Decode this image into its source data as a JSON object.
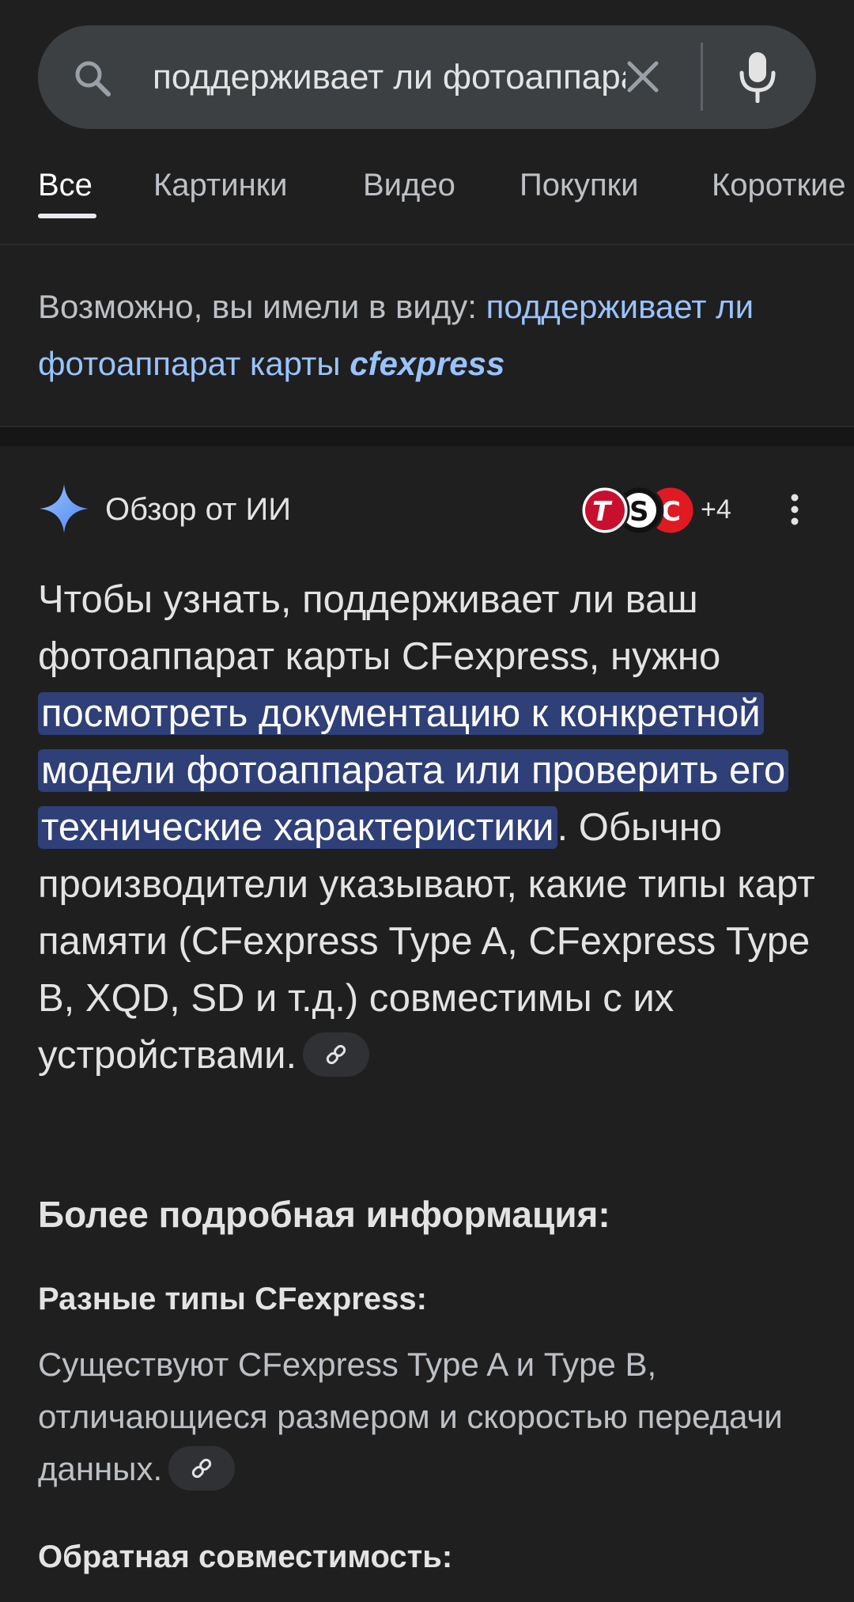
{
  "search": {
    "query": "поддерживает ли фотоаппарат"
  },
  "tabs": [
    {
      "label": "Все",
      "active": true
    },
    {
      "label": "Картинки",
      "active": false
    },
    {
      "label": "Видео",
      "active": false
    },
    {
      "label": "Покупки",
      "active": false
    },
    {
      "label": "Короткие",
      "active": false
    }
  ],
  "did_you_mean": {
    "prefix": "Возможно, вы имели в виду:",
    "suggestion": "поддерживает ли фотоаппарат карты",
    "suggestion_emphasis": "cfexpress"
  },
  "ai_overview": {
    "title": "Обзор от ИИ",
    "source_count": "+4",
    "body_start": "Чтобы узнать, поддерживает ли ваш фотоаппарат карты CFexpress, нужно ",
    "body_highlight": "посмотреть документацию к конкретной модели фотоаппарата или проверить его технические характеристики",
    "body_end": ". Обычно производители указывают, какие типы карт памяти (CFexpress Type A, CFexpress Type B, XQD, SD и т.д.) совместимы с их устройствами.",
    "more_info_heading": "Более подробная информация:",
    "sections": [
      {
        "title": "Разные типы CFexpress:",
        "text": "Существуют CFexpress Type A и Type B, отличающиеся размером и скоростью передачи данных."
      },
      {
        "title": "Обратная совместимость:"
      }
    ]
  },
  "colors": {
    "background": "#1f1f1f",
    "search_bar": "#3c4043",
    "link": "#99c3ff",
    "highlight": "#2f3f78",
    "ai_star": "#7ab0ff"
  }
}
